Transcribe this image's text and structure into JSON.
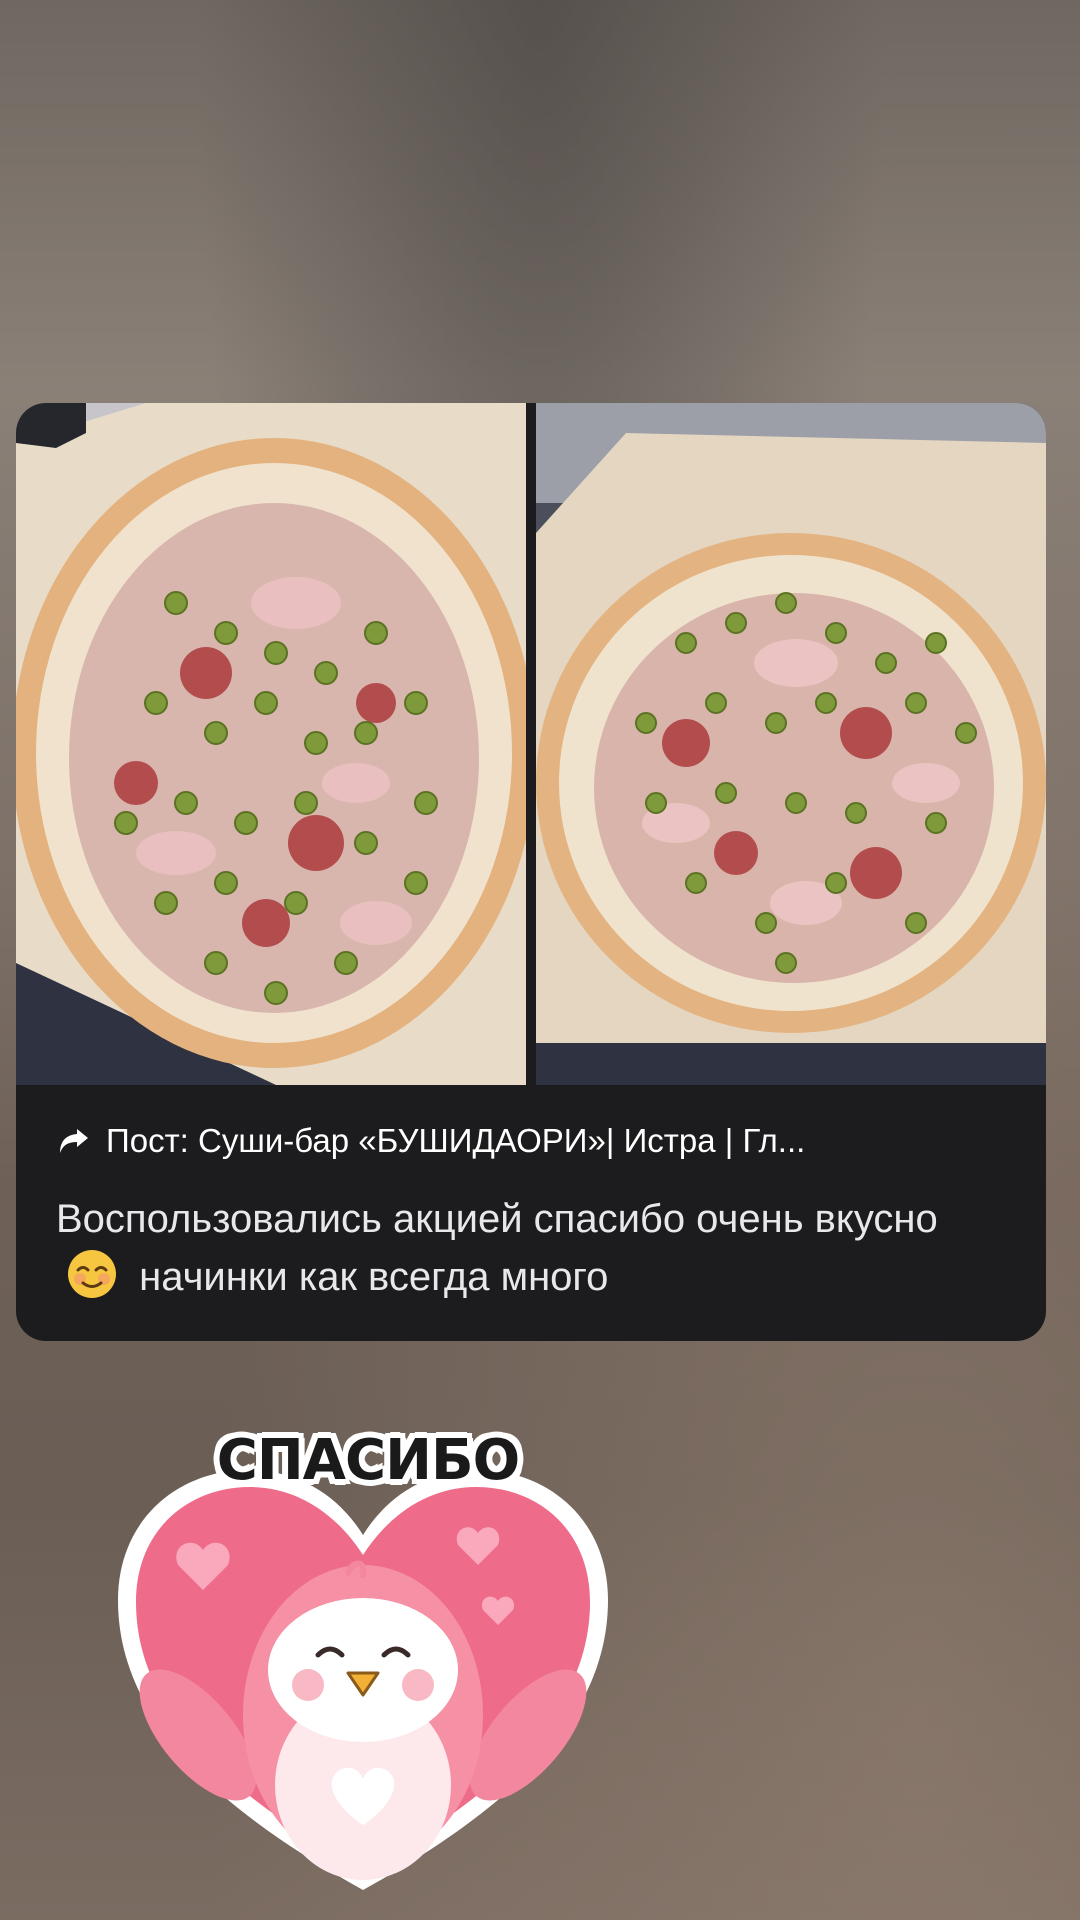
{
  "repost": {
    "icon": "reply-arrow-icon",
    "text": "Пост: Суши-бар «БУШИДАОРИ»| Истра | Гл..."
  },
  "message": {
    "text_before_emoji": "Воспользовались акцией спасибо очень вкусно",
    "emoji": "☺️",
    "text_after_emoji": "начинки как всегда много"
  },
  "photos": [
    {
      "icon": "pizza-photo-1"
    },
    {
      "icon": "pizza-photo-2"
    }
  ],
  "sticker": {
    "word": "СПАСИБО",
    "icon": "penguin-heart-sticker"
  },
  "colors": {
    "card_bg": "#1c1c1e",
    "text": "#ffffff",
    "heart": "#ef6b8a"
  }
}
